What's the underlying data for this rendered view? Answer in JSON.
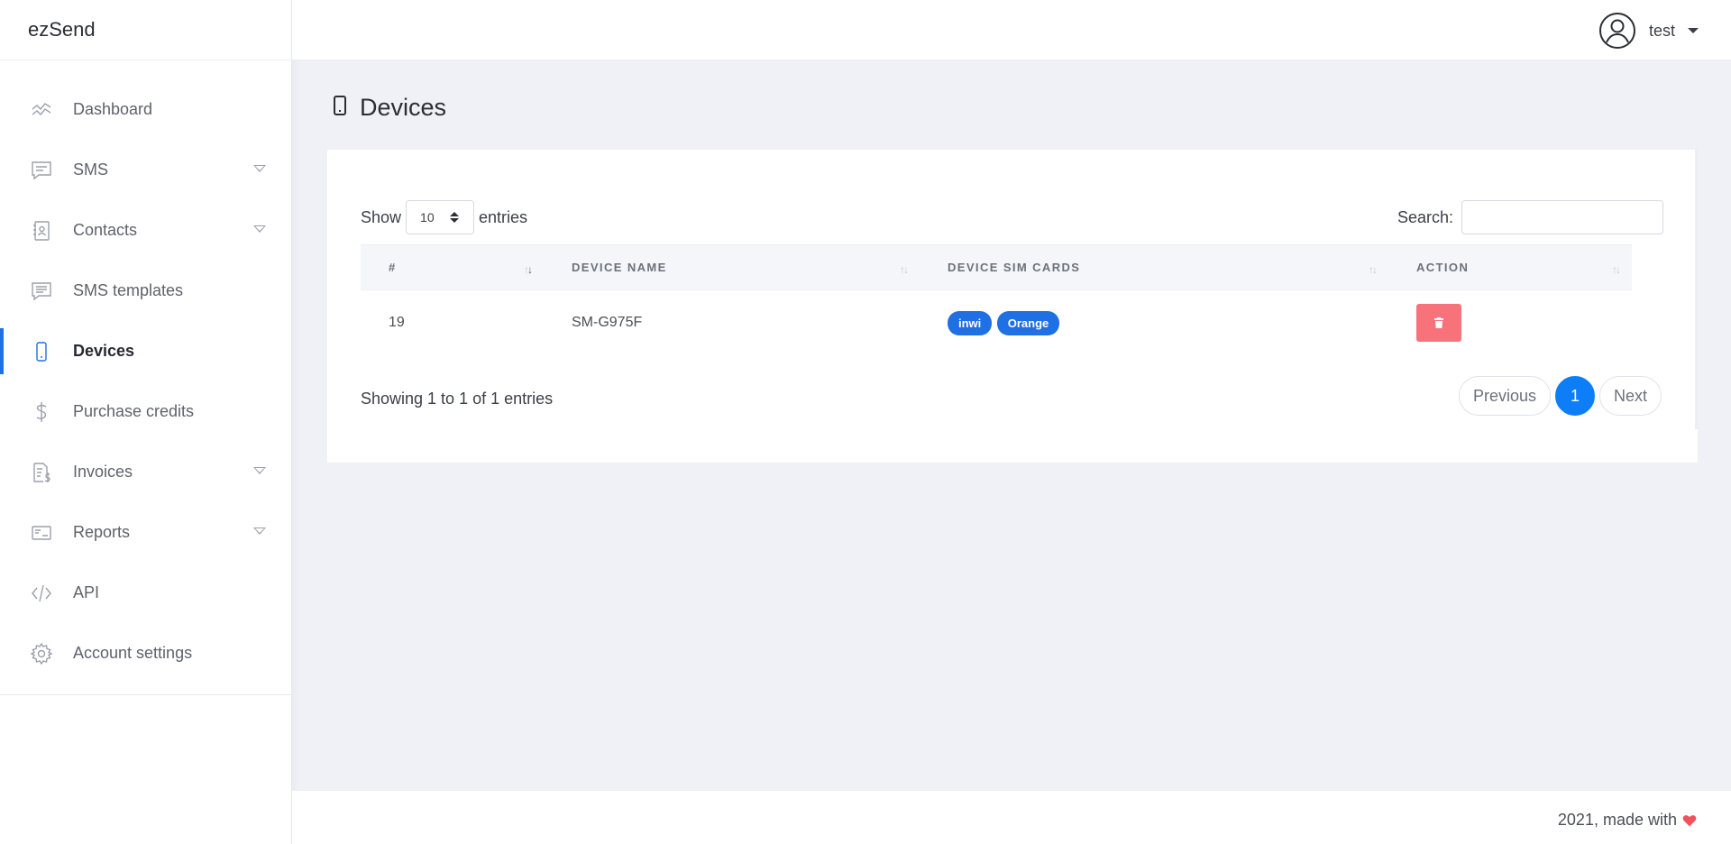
{
  "brand": "ezSend",
  "user": {
    "name": "test"
  },
  "sidebar": {
    "items": [
      {
        "label": "Dashboard",
        "icon": "dashboard-icon",
        "dropdown": false
      },
      {
        "label": "SMS",
        "icon": "sms-icon",
        "dropdown": true
      },
      {
        "label": "Contacts",
        "icon": "contacts-icon",
        "dropdown": true
      },
      {
        "label": "SMS templates",
        "icon": "sms-templates-icon",
        "dropdown": false
      },
      {
        "label": "Devices",
        "icon": "device-icon",
        "dropdown": false,
        "active": true
      },
      {
        "label": "Purchase credits",
        "icon": "dollar-icon",
        "dropdown": false
      },
      {
        "label": "Invoices",
        "icon": "invoice-icon",
        "dropdown": true
      },
      {
        "label": "Reports",
        "icon": "reports-icon",
        "dropdown": true
      },
      {
        "label": "API",
        "icon": "code-icon",
        "dropdown": false
      },
      {
        "label": "Account settings",
        "icon": "gear-icon",
        "dropdown": false
      }
    ]
  },
  "page": {
    "title": "Devices"
  },
  "table_controls": {
    "show_label": "Show",
    "entries_value": "10",
    "entries_label": "entries",
    "search_label": "Search:",
    "search_value": ""
  },
  "table": {
    "columns": [
      "#",
      "DEVICE NAME",
      "DEVICE SIM CARDS",
      "ACTION"
    ],
    "rows": [
      {
        "id": "19",
        "device_name": "SM-G975F",
        "sim_cards": [
          "inwi",
          "Orange"
        ]
      }
    ]
  },
  "pagination": {
    "info": "Showing 1 to 1 of 1 entries",
    "previous": "Previous",
    "current": "1",
    "next": "Next"
  },
  "footer": {
    "text": "2021, made with"
  },
  "colors": {
    "accent": "#1f6fe5",
    "danger": "#f8727c",
    "heart": "#f0525d",
    "page_bg": "#eff1f6"
  }
}
